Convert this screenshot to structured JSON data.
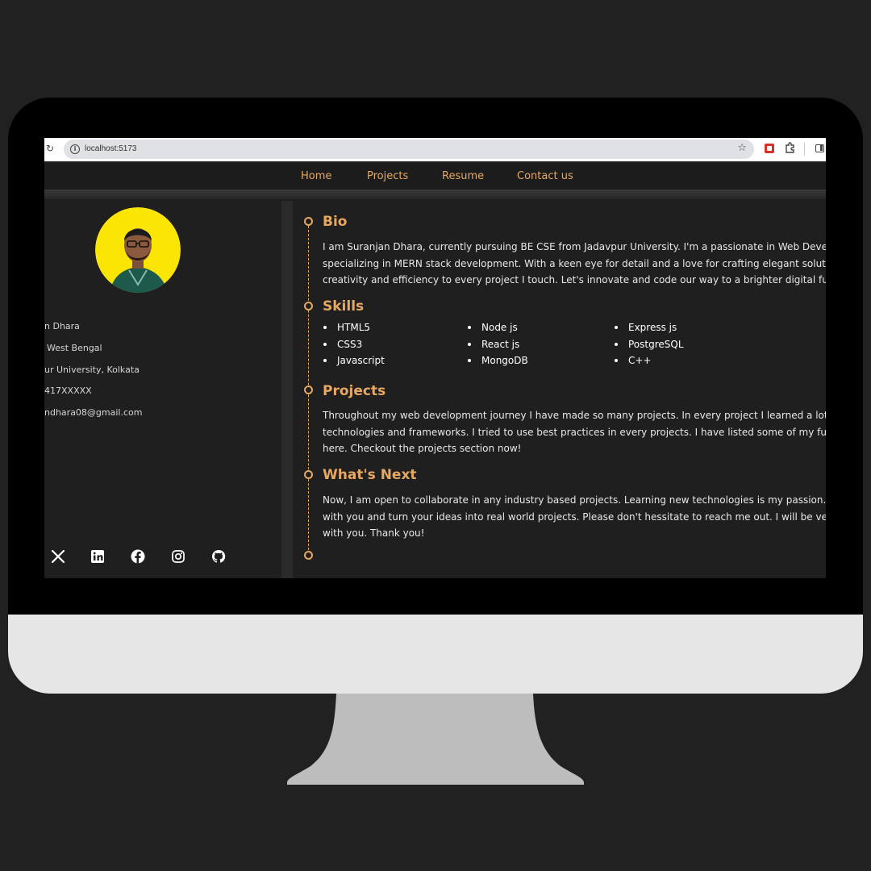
{
  "browser": {
    "url": "localhost:5173"
  },
  "nav": {
    "items": [
      "Home",
      "Projects",
      "Resume",
      "Contact us"
    ]
  },
  "profile": {
    "lines": [
      "n Dhara",
      "West Bengal",
      "ur University, Kolkata",
      "417XXXXX",
      "ndhara08@gmail.com"
    ],
    "social": [
      "x-icon",
      "linkedin-icon",
      "facebook-icon",
      "instagram-icon",
      "github-icon"
    ]
  },
  "bio": {
    "title": "Bio",
    "lines": [
      "I am Suranjan Dhara, currently pursuing BE CSE from Jadavpur University. I'm a passionate in Web Develo",
      "specializing in MERN stack development. With a keen eye for detail and a love for crafting elegant solutions, I",
      "creativity and efficiency to every project I touch. Let's innovate and code our way to a brighter digital future toget"
    ]
  },
  "skills": {
    "title": "Skills",
    "col1": [
      "HTML5",
      "CSS3",
      "Javascript"
    ],
    "col2": [
      "Node js",
      "React js",
      "MongoDB"
    ],
    "col3": [
      "Express js",
      "PostgreSQL",
      "C++"
    ]
  },
  "projects": {
    "title": "Projects",
    "lines": [
      "Throughout my web development journey I have made so many projects. In every project I learned a lot about di",
      "technologies and frameworks. I tried to use best practices in every projects. I have listed some of my full stack p",
      "here. Checkout the projects section now!"
    ]
  },
  "next": {
    "title": "What's Next",
    "lines": [
      "Now, I am open to collaborate in any industry based projects. Learning new technologies is my passion. I love to",
      "with you and turn your ideas into real world projects. Please don't hessitate to reach me out. I will be very glad to",
      "with you. Thank you!"
    ]
  },
  "colors": {
    "accent": "#e6a862",
    "background": "#1f1f1f",
    "page": "#212121"
  }
}
